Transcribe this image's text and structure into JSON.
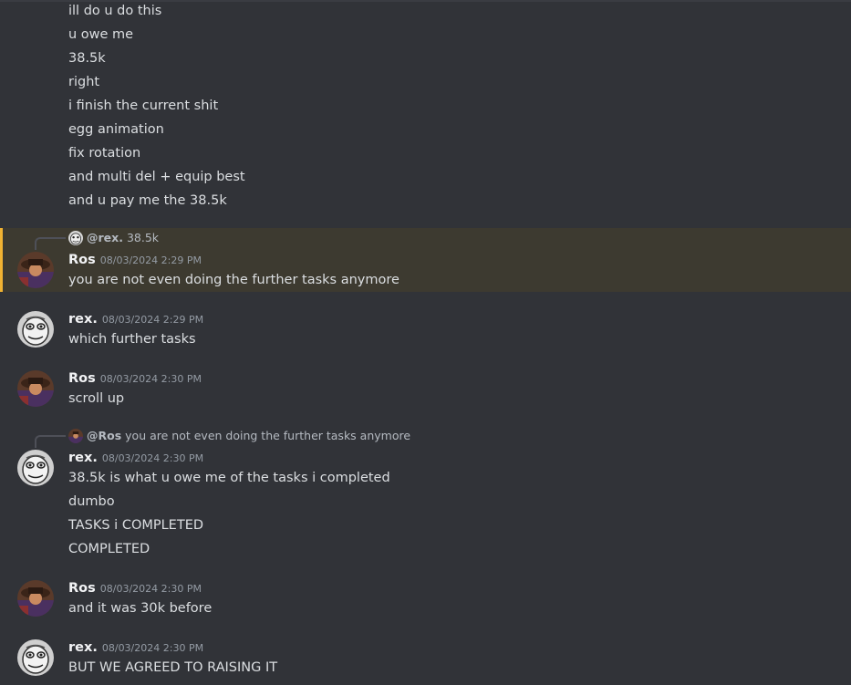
{
  "top_messages": [
    "ill do u do this",
    "u owe me",
    "38.5k",
    "right",
    "i finish the current shit",
    "egg animation",
    "fix rotation",
    "and multi del + equip best",
    "and u pay me the 38.5k"
  ],
  "msg1": {
    "reply_user": "@rex.",
    "reply_text": "38.5k",
    "author": "Ros",
    "timestamp": "08/03/2024 2:29 PM",
    "text": "you are not even doing the further tasks anymore"
  },
  "msg2": {
    "author": "rex.",
    "timestamp": "08/03/2024 2:29 PM",
    "text": "which further tasks"
  },
  "msg3": {
    "author": "Ros",
    "timestamp": "08/03/2024 2:30 PM",
    "text": "scroll up"
  },
  "msg4": {
    "reply_user": "@Ros",
    "reply_text": "you are not even doing the further tasks anymore",
    "author": "rex.",
    "timestamp": "08/03/2024 2:30 PM",
    "lines": [
      "38.5k is what u owe me of the tasks i completed",
      "dumbo",
      "TASKS i COMPLETED",
      "COMPLETED"
    ]
  },
  "msg5": {
    "author": "Ros",
    "timestamp": "08/03/2024 2:30 PM",
    "text": "and it was 30k before"
  },
  "msg6": {
    "author": "rex.",
    "timestamp": "08/03/2024 2:30 PM",
    "text": "BUT WE AGREED TO RAISING IT"
  },
  "colors": {
    "background": "#313338",
    "mention_highlight": "#3d3a30",
    "mention_bar": "#f0b232",
    "timestamp": "#949ba4"
  }
}
